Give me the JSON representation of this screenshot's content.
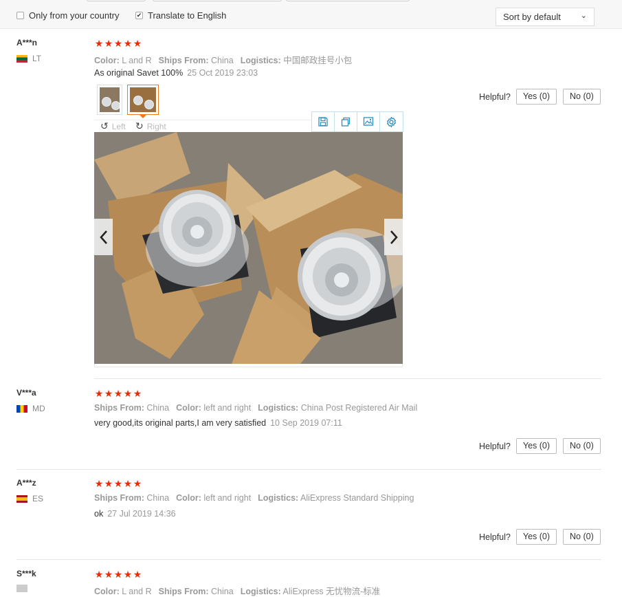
{
  "filters": {
    "only_country_label": "Only from your country",
    "only_country_checked": false,
    "translate_label": "Translate to English",
    "translate_checked": true,
    "sort": {
      "value": "Sort by default"
    }
  },
  "icons": {
    "checkmark": "✔",
    "star": "★",
    "chevron_down": "⌄",
    "rotate_left": "↺",
    "rotate_right": "↻"
  },
  "colors": {
    "star": "#e62e04",
    "active_thumb": "#f27a1a",
    "toolbar_icon": "#2a8fbd",
    "flag_LT": [
      "#fdb913",
      "#006a44",
      "#c1272d"
    ],
    "flag_MD": [
      "#0046ae",
      "#ffd200",
      "#cc092f"
    ],
    "flag_ES": [
      "#aa151b",
      "#f1bf00",
      "#aa151b"
    ],
    "flag_XX": [
      "#cccccc",
      "#cccccc",
      "#cccccc"
    ]
  },
  "image_viewer": {
    "rotate_left_label": "Left",
    "rotate_right_label": "Right"
  },
  "helpful_label": "Helpful?",
  "reviews": [
    {
      "name": "A***n",
      "country": "LT",
      "rating": 5,
      "meta": [
        {
          "key": "Color:",
          "value": "L and R"
        },
        {
          "key": "Ships From:",
          "value": "China"
        },
        {
          "key": "Logistics:",
          "value": "中国邮政挂号小包"
        }
      ],
      "text": "As original Savet 100%",
      "date": "25 Oct 2019 23:03",
      "yes": "Yes (0)",
      "no": "No (0)"
    },
    {
      "name": "V***a",
      "country": "MD",
      "rating": 5,
      "meta": [
        {
          "key": "Ships From:",
          "value": "China"
        },
        {
          "key": "Color:",
          "value": "left and right"
        },
        {
          "key": "Logistics:",
          "value": "China Post Registered Air Mail"
        }
      ],
      "text": "very good,its original parts,I am very satisfied",
      "date": "10 Sep 2019 07:11",
      "yes": "Yes (0)",
      "no": "No (0)"
    },
    {
      "name": "A***z",
      "country": "ES",
      "rating": 5,
      "meta": [
        {
          "key": "Ships From:",
          "value": "China"
        },
        {
          "key": "Color:",
          "value": "left and right"
        },
        {
          "key": "Logistics:",
          "value": "AliExpress Standard Shipping"
        }
      ],
      "text": "ok",
      "date": "27 Jul 2019 14:36",
      "yes": "Yes (0)",
      "no": "No (0)"
    },
    {
      "name": "S***k",
      "country": "",
      "rating": 5,
      "meta": [
        {
          "key": "Color:",
          "value": "L and R"
        },
        {
          "key": "Ships From:",
          "value": "China"
        },
        {
          "key": "Logistics:",
          "value": "AliExpress 无忧物流-标准"
        }
      ]
    }
  ]
}
